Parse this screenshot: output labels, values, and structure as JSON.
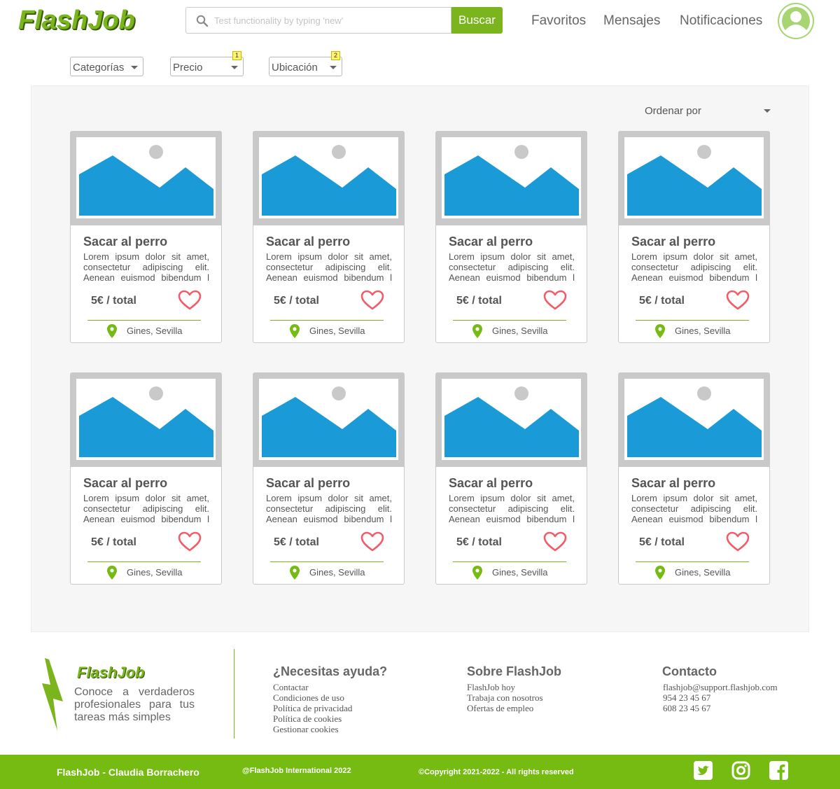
{
  "header": {
    "logo": "FlashJob",
    "search_placeholder": "Test functionality by typing 'new'",
    "search_button": "Buscar",
    "nav": [
      "Favoritos",
      "Mensajes",
      "Notificaciones"
    ],
    "avatar_icon": "user-avatar-icon"
  },
  "filters": [
    {
      "label": "Categorías",
      "badge": ""
    },
    {
      "label": "Precio",
      "badge": "1"
    },
    {
      "label": "Ubicación",
      "badge": "2"
    }
  ],
  "sort_label": "Ordenar por",
  "cards": [
    {
      "title": "Sacar al perro",
      "description": "Lorem ipsum dolor sit amet, consectetur adipiscing elit. Aenean euismod bibendum l",
      "price": "5€ / total",
      "location": "Gines, Sevilla"
    },
    {
      "title": "Sacar al perro",
      "description": "Lorem ipsum dolor sit amet, consectetur adipiscing elit. Aenean euismod bibendum l",
      "price": "5€ / total",
      "location": "Gines, Sevilla"
    },
    {
      "title": "Sacar al perro",
      "description": "Lorem ipsum dolor sit amet, consectetur adipiscing elit. Aenean euismod bibendum l",
      "price": "5€ / total",
      "location": "Gines, Sevilla"
    },
    {
      "title": "Sacar al perro",
      "description": "Lorem ipsum dolor sit amet, consectetur adipiscing elit. Aenean euismod bibendum l",
      "price": "5€ / total",
      "location": "Gines, Sevilla"
    },
    {
      "title": "Sacar al perro",
      "description": "Lorem ipsum dolor sit amet, consectetur adipiscing elit. Aenean euismod bibendum l",
      "price": "5€ / total",
      "location": "Gines, Sevilla"
    },
    {
      "title": "Sacar al perro",
      "description": "Lorem ipsum dolor sit amet, consectetur adipiscing elit. Aenean euismod bibendum l",
      "price": "5€ / total",
      "location": "Gines, Sevilla"
    },
    {
      "title": "Sacar al perro",
      "description": "Lorem ipsum dolor sit amet, consectetur adipiscing elit. Aenean euismod bibendum l",
      "price": "5€ / total",
      "location": "Gines, Sevilla"
    },
    {
      "title": "Sacar al perro",
      "description": "Lorem ipsum dolor sit amet, consectetur adipiscing elit. Aenean euismod bibendum l",
      "price": "5€ / total",
      "location": "Gines, Sevilla"
    }
  ],
  "footer": {
    "logo": "FlashJob",
    "tagline": "Conoce a verdaderos profesionales para tus tareas más simples",
    "help": {
      "heading": "¿Necesitas ayuda?",
      "links": [
        "Contactar",
        "Condiciones de uso",
        "Política de privacidad",
        "Política de cookies",
        "Gestionar cookies"
      ]
    },
    "about": {
      "heading": "Sobre FlashJob",
      "links": [
        "FlashJob hoy",
        "Trabaja con nosotros",
        "Ofertas de empleo"
      ]
    },
    "contact": {
      "heading": "Contacto",
      "lines": [
        "flashjob@support.flashjob.com",
        "954 23 45 67",
        "608 23 45 67"
      ]
    }
  },
  "bottom_bar": {
    "author": "FlashJob - Claudia Borrachero",
    "international": "@FlashJob International 2022",
    "copyright": "©Copyright  2021-2022 - All rights reserved",
    "social": [
      "twitter-icon",
      "instagram-icon",
      "facebook-icon"
    ]
  },
  "colors": {
    "brand_green": "#76bb12",
    "image_blue": "#1a9bd7",
    "heart_red": "#f45b69"
  }
}
